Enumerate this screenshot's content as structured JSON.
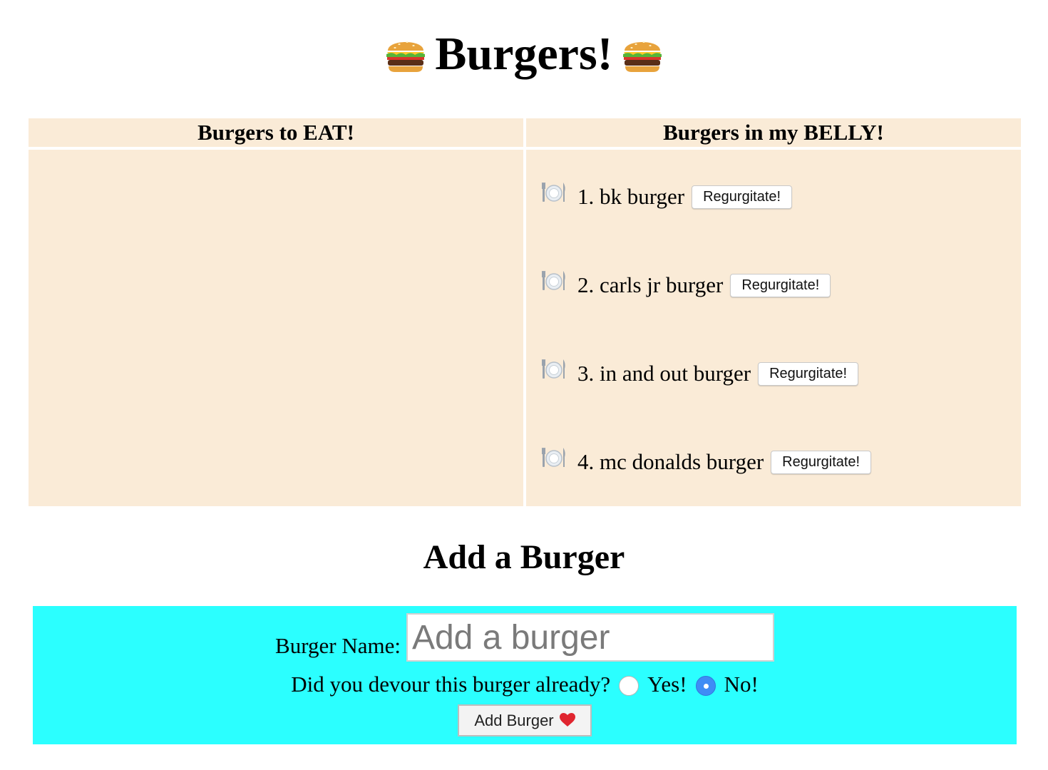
{
  "header": {
    "title": "Burgers!",
    "left_icon": "hamburger-emoji",
    "right_icon": "hamburger-emoji"
  },
  "columns": {
    "to_eat": {
      "heading": "Burgers to EAT!",
      "items": []
    },
    "belly": {
      "heading": "Burgers in my BELLY!",
      "item_icon": "fork-knife-plate-emoji",
      "button_label": "Regurgitate!",
      "items": [
        {
          "number": "1.",
          "name": "bk burger"
        },
        {
          "number": "2.",
          "name": "carls jr burger"
        },
        {
          "number": "3.",
          "name": "in and out burger"
        },
        {
          "number": "4.",
          "name": "mc donalds burger"
        }
      ]
    }
  },
  "add_form": {
    "title": "Add a Burger",
    "name_label": "Burger Name:",
    "name_placeholder": "Add a burger",
    "name_value": "",
    "devour_question": "Did you devour this burger already?",
    "yes_label": "Yes!",
    "no_label": "No!",
    "selected": "No!",
    "submit_label": "Add Burger",
    "submit_icon": "red-heart-emoji"
  },
  "colors": {
    "table_bg": "#FAEBD7",
    "form_bg": "#2BFFFF",
    "radio_selected": "#3F8CF5"
  }
}
